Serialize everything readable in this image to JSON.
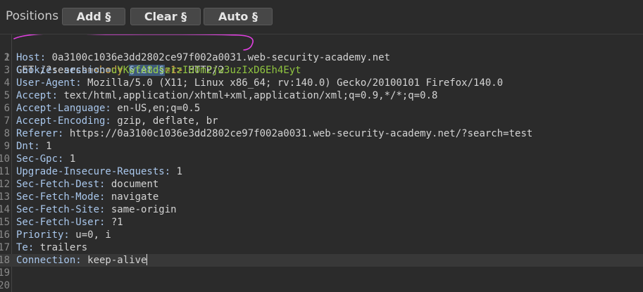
{
  "toolbar": {
    "title": "Positions",
    "add_label": "Add §",
    "clear_label": "Clear §",
    "auto_label": "Auto §"
  },
  "request": {
    "line1": {
      "num": "1",
      "method": "GET /?search=",
      "html_open": "<body ",
      "marker": "§teto§",
      "html_close": "=1>",
      "protocol": " HTTP/2"
    },
    "headers": [
      {
        "num": "2",
        "name": "Host:",
        "value": " 0a3100c1036e3dd2802ce97f002a0031.web-security-academy.net"
      },
      {
        "num": "3",
        "name": "Cookie:",
        "value": " ",
        "cookie_name": "session=",
        "cookie_value": "uYKwfA8dszrzI60m2jw3uzIxD6Eh4Eyt"
      },
      {
        "num": "4",
        "name": "User-Agent:",
        "value": " Mozilla/5.0 (X11; Linux x86_64; rv:140.0) Gecko/20100101 Firefox/140.0"
      },
      {
        "num": "5",
        "name": "Accept:",
        "value": " text/html,application/xhtml+xml,application/xml;q=0.9,*/*;q=0.8"
      },
      {
        "num": "6",
        "name": "Accept-Language:",
        "value": " en-US,en;q=0.5"
      },
      {
        "num": "7",
        "name": "Accept-Encoding:",
        "value": " gzip, deflate, br"
      },
      {
        "num": "8",
        "name": "Referer:",
        "value": " https://0a3100c1036e3dd2802ce97f002a0031.web-security-academy.net/?search=test"
      },
      {
        "num": "9",
        "name": "Dnt:",
        "value": " 1"
      },
      {
        "num": "10",
        "name": "Sec-Gpc:",
        "value": " 1"
      },
      {
        "num": "11",
        "name": "Upgrade-Insecure-Requests:",
        "value": " 1"
      },
      {
        "num": "12",
        "name": "Sec-Fetch-Dest:",
        "value": " document"
      },
      {
        "num": "13",
        "name": "Sec-Fetch-Mode:",
        "value": " navigate"
      },
      {
        "num": "14",
        "name": "Sec-Fetch-Site:",
        "value": " same-origin"
      },
      {
        "num": "15",
        "name": "Sec-Fetch-User:",
        "value": " ?1"
      },
      {
        "num": "16",
        "name": "Priority:",
        "value": " u=0, i"
      },
      {
        "num": "17",
        "name": "Te:",
        "value": " trailers"
      },
      {
        "num": "18",
        "name": "Connection:",
        "value": " keep-alive"
      }
    ],
    "empty_lines": [
      "19",
      "20"
    ]
  },
  "colors": {
    "background": "#2b2b2b",
    "header_name": "#a9c7ec",
    "cookie_value": "#8fc440",
    "html_tag": "#d4a54a",
    "annotation": "#e040e0"
  }
}
